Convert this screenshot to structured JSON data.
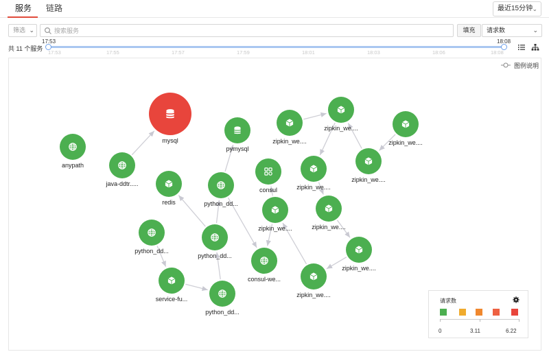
{
  "tabs": [
    {
      "label": "服务",
      "active": true
    },
    {
      "label": "链路",
      "active": false
    }
  ],
  "time_range": "最近15分钟",
  "filter": {
    "label": "筛选"
  },
  "search": {
    "placeholder": "搜索服务"
  },
  "fill_button": "填充",
  "metric": "请求数",
  "count_label": "共 11 个服务",
  "slider": {
    "start": "17:53",
    "end": "18:08",
    "ticks": [
      "17:53",
      "17:55",
      "17:57",
      "17:59",
      "18:01",
      "18:03",
      "18:06",
      "18:08"
    ]
  },
  "legend_toggle": "图例说明",
  "colors": {
    "node_green": "#4caf50",
    "node_red": "#e8453c",
    "edge": "#cfcfd6",
    "accent": "#e04a3a"
  },
  "nodes": [
    {
      "id": "mysql",
      "label": "mysql",
      "icon": "database-icon",
      "color": "red"
    },
    {
      "id": "anypath",
      "label": "anypath",
      "icon": "globe-icon",
      "color": "green"
    },
    {
      "id": "java",
      "label": "java-ddtr.....",
      "icon": "globe-icon",
      "color": "green"
    },
    {
      "id": "pymysql",
      "label": "pymysql",
      "icon": "database-icon",
      "color": "green"
    },
    {
      "id": "redis",
      "label": "redis",
      "icon": "cube-icon",
      "color": "green"
    },
    {
      "id": "consul",
      "label": "consul",
      "icon": "apps-icon",
      "color": "green"
    },
    {
      "id": "py1",
      "label": "python_dd...",
      "icon": "globe-icon",
      "color": "green"
    },
    {
      "id": "py2",
      "label": "python_dd...",
      "icon": "globe-icon",
      "color": "green"
    },
    {
      "id": "py3",
      "label": "python_dd...",
      "icon": "globe-icon",
      "color": "green"
    },
    {
      "id": "py4",
      "label": "python_dd...",
      "icon": "globe-icon",
      "color": "green"
    },
    {
      "id": "svc",
      "label": "service-fu...",
      "icon": "cube-icon",
      "color": "green"
    },
    {
      "id": "consulwe",
      "label": "consul-we...",
      "icon": "globe-icon",
      "color": "green"
    },
    {
      "id": "z1",
      "label": "zipkin_we....",
      "icon": "cube-icon",
      "color": "green"
    },
    {
      "id": "z2",
      "label": "zipkin_we....",
      "icon": "cube-icon",
      "color": "green"
    },
    {
      "id": "z3",
      "label": "zipkin_we....",
      "icon": "cube-icon",
      "color": "green"
    },
    {
      "id": "z4",
      "label": "zipkin_we....",
      "icon": "cube-icon",
      "color": "green"
    },
    {
      "id": "z5",
      "label": "zipkin_we....",
      "icon": "cube-icon",
      "color": "green"
    },
    {
      "id": "z6",
      "label": "zipkin_we....",
      "icon": "cube-icon",
      "color": "green"
    },
    {
      "id": "z7",
      "label": "zipkin_we....",
      "icon": "cube-icon",
      "color": "green"
    },
    {
      "id": "z8",
      "label": "zipkin_we....",
      "icon": "cube-icon",
      "color": "green"
    },
    {
      "id": "z9",
      "label": "zipkin_we....",
      "icon": "cube-icon",
      "color": "green"
    },
    {
      "id": "z10",
      "label": "zipkin_we....",
      "icon": "cube-icon",
      "color": "green"
    }
  ],
  "edges": [
    [
      "java",
      "mysql"
    ],
    [
      "py1",
      "pymysql"
    ],
    [
      "py2",
      "py1"
    ],
    [
      "py2",
      "redis"
    ],
    [
      "py1",
      "consulwe"
    ],
    [
      "z5",
      "consul"
    ],
    [
      "z5",
      "consulwe"
    ],
    [
      "py3",
      "svc"
    ],
    [
      "svc",
      "py4"
    ],
    [
      "py4",
      "py2"
    ],
    [
      "z1",
      "z2"
    ],
    [
      "z2",
      "z4"
    ],
    [
      "z3",
      "z2"
    ],
    [
      "z4",
      "z6"
    ],
    [
      "z6",
      "z8"
    ],
    [
      "z8",
      "z9"
    ],
    [
      "z9",
      "z10"
    ],
    [
      "z10",
      "z5"
    ],
    [
      "z7",
      "z3"
    ]
  ],
  "legend": {
    "title": "请求数",
    "swatches": [
      "#4caf50",
      "#f0ab2e",
      "#f0882e",
      "#ee6142",
      "#e8453c"
    ],
    "labels": [
      "0",
      "3.11",
      "6.22"
    ]
  }
}
